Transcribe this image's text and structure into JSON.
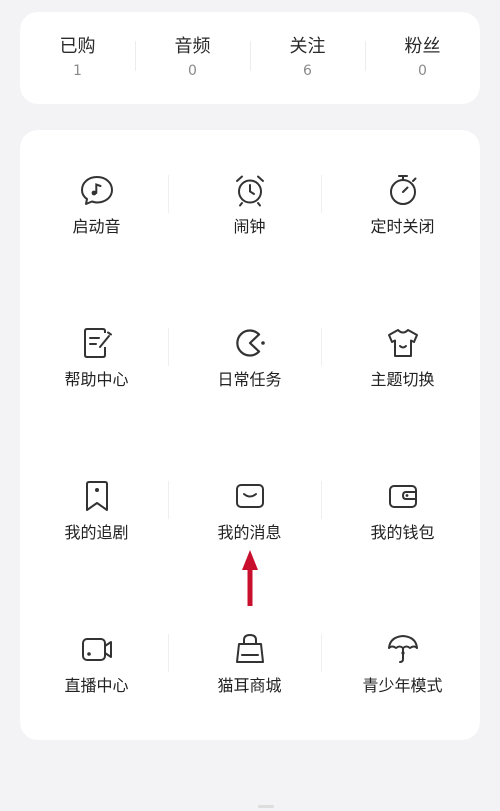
{
  "stats": [
    {
      "label": "已购",
      "value": "1"
    },
    {
      "label": "音频",
      "value": "0"
    },
    {
      "label": "关注",
      "value": "6"
    },
    {
      "label": "粉丝",
      "value": "0"
    }
  ],
  "grid": [
    {
      "label": "启动音",
      "icon": "music-bubble-icon"
    },
    {
      "label": "闹钟",
      "icon": "alarm-clock-icon"
    },
    {
      "label": "定时关闭",
      "icon": "timer-icon"
    },
    {
      "label": "帮助中心",
      "icon": "edit-note-icon"
    },
    {
      "label": "日常任务",
      "icon": "pacman-icon"
    },
    {
      "label": "主题切换",
      "icon": "tshirt-icon"
    },
    {
      "label": "我的追剧",
      "icon": "bookmark-icon"
    },
    {
      "label": "我的消息",
      "icon": "message-icon"
    },
    {
      "label": "我的钱包",
      "icon": "wallet-icon"
    },
    {
      "label": "直播中心",
      "icon": "video-camera-icon"
    },
    {
      "label": "猫耳商城",
      "icon": "shopping-bag-icon"
    },
    {
      "label": "青少年模式",
      "icon": "umbrella-icon"
    }
  ],
  "colors": {
    "background": "#f3f3f5",
    "card": "#ffffff",
    "text": "#222222",
    "muted": "#8a8a8a",
    "arrow": "#c8102e"
  }
}
